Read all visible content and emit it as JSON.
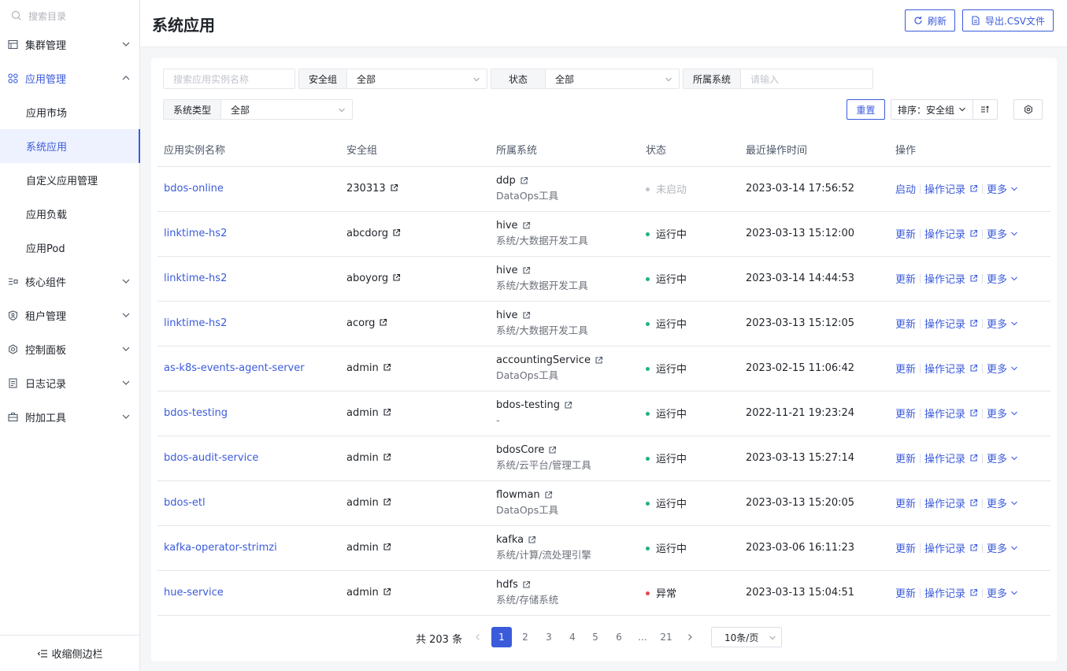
{
  "sidebar": {
    "search_placeholder": "搜索目录",
    "items": [
      {
        "label": "集群管理"
      },
      {
        "label": "应用管理",
        "sub": [
          "应用市场",
          "系统应用",
          "自定义应用管理",
          "应用负载",
          "应用Pod"
        ]
      },
      {
        "label": "核心组件"
      },
      {
        "label": "租户管理"
      },
      {
        "label": "控制面板"
      },
      {
        "label": "日志记录"
      },
      {
        "label": "附加工具"
      }
    ],
    "collapse_label": "收缩侧边栏"
  },
  "header": {
    "title": "系统应用",
    "refresh_label": "刷新",
    "export_label": "导出.CSV文件"
  },
  "filters": {
    "name_placeholder": "搜索应用实例名称",
    "security_group": {
      "label": "安全组",
      "value": "全部"
    },
    "status": {
      "label": "状态",
      "value": "全部"
    },
    "system": {
      "label": "所属系统",
      "placeholder": "请输入"
    },
    "system_type": {
      "label": "系统类型",
      "value": "全部"
    }
  },
  "toolbar": {
    "reset_label": "重置",
    "sort_label": "排序：安全组"
  },
  "table": {
    "columns": [
      "应用实例名称",
      "安全组",
      "所属系统",
      "状态",
      "最近操作时间",
      "操作"
    ],
    "rows": [
      {
        "name": "bdos-online",
        "group": "230313",
        "sys": "ddp",
        "sys_sub": "DataOps工具",
        "status": "未启动",
        "time": "2023-03-14 17:56:52",
        "op1": "启动"
      },
      {
        "name": "linktime-hs2",
        "group": "abcdorg",
        "sys": "hive",
        "sys_sub": "系统/大数据开发工具",
        "status": "运行中",
        "time": "2023-03-13 15:12:00",
        "op1": "更新"
      },
      {
        "name": "linktime-hs2",
        "group": "aboyorg",
        "sys": "hive",
        "sys_sub": "系统/大数据开发工具",
        "status": "运行中",
        "time": "2023-03-14 14:44:53",
        "op1": "更新"
      },
      {
        "name": "linktime-hs2",
        "group": "acorg",
        "sys": "hive",
        "sys_sub": "系统/大数据开发工具",
        "status": "运行中",
        "time": "2023-03-13 15:12:05",
        "op1": "更新"
      },
      {
        "name": "as-k8s-events-agent-server",
        "group": "admin",
        "sys": "accountingService",
        "sys_sub": "DataOps工具",
        "status": "运行中",
        "time": "2023-02-15 11:06:42",
        "op1": "更新"
      },
      {
        "name": "bdos-testing",
        "group": "admin",
        "sys": "bdos-testing",
        "sys_sub": "-",
        "status": "运行中",
        "time": "2022-11-21 19:23:24",
        "op1": "更新"
      },
      {
        "name": "bdos-audit-service",
        "group": "admin",
        "sys": "bdosCore",
        "sys_sub": "系统/云平台/管理工具",
        "status": "运行中",
        "time": "2023-03-13 15:27:14",
        "op1": "更新"
      },
      {
        "name": "bdos-etl",
        "group": "admin",
        "sys": "flowman",
        "sys_sub": "DataOps工具",
        "status": "运行中",
        "time": "2023-03-13 15:20:05",
        "op1": "更新"
      },
      {
        "name": "kafka-operator-strimzi",
        "group": "admin",
        "sys": "kafka",
        "sys_sub": "系统/计算/流处理引擎",
        "status": "运行中",
        "time": "2023-03-06 16:11:23",
        "op1": "更新"
      },
      {
        "name": "hue-service",
        "group": "admin",
        "sys": "hdfs",
        "sys_sub": "系统/存储系统",
        "status": "异常",
        "time": "2023-03-13 15:04:51",
        "op1": "更新"
      }
    ],
    "op_log": "操作记录",
    "op_more": "更多"
  },
  "pagination": {
    "total": "共 203 条",
    "pages": [
      "1",
      "2",
      "3",
      "4",
      "5",
      "6",
      "...",
      "21"
    ],
    "page_size": "10条/页"
  },
  "colors": {
    "accent": "#3b5bdb",
    "running": "#1fb47a",
    "stopped": "#c0c4cc",
    "error": "#e5484d"
  }
}
